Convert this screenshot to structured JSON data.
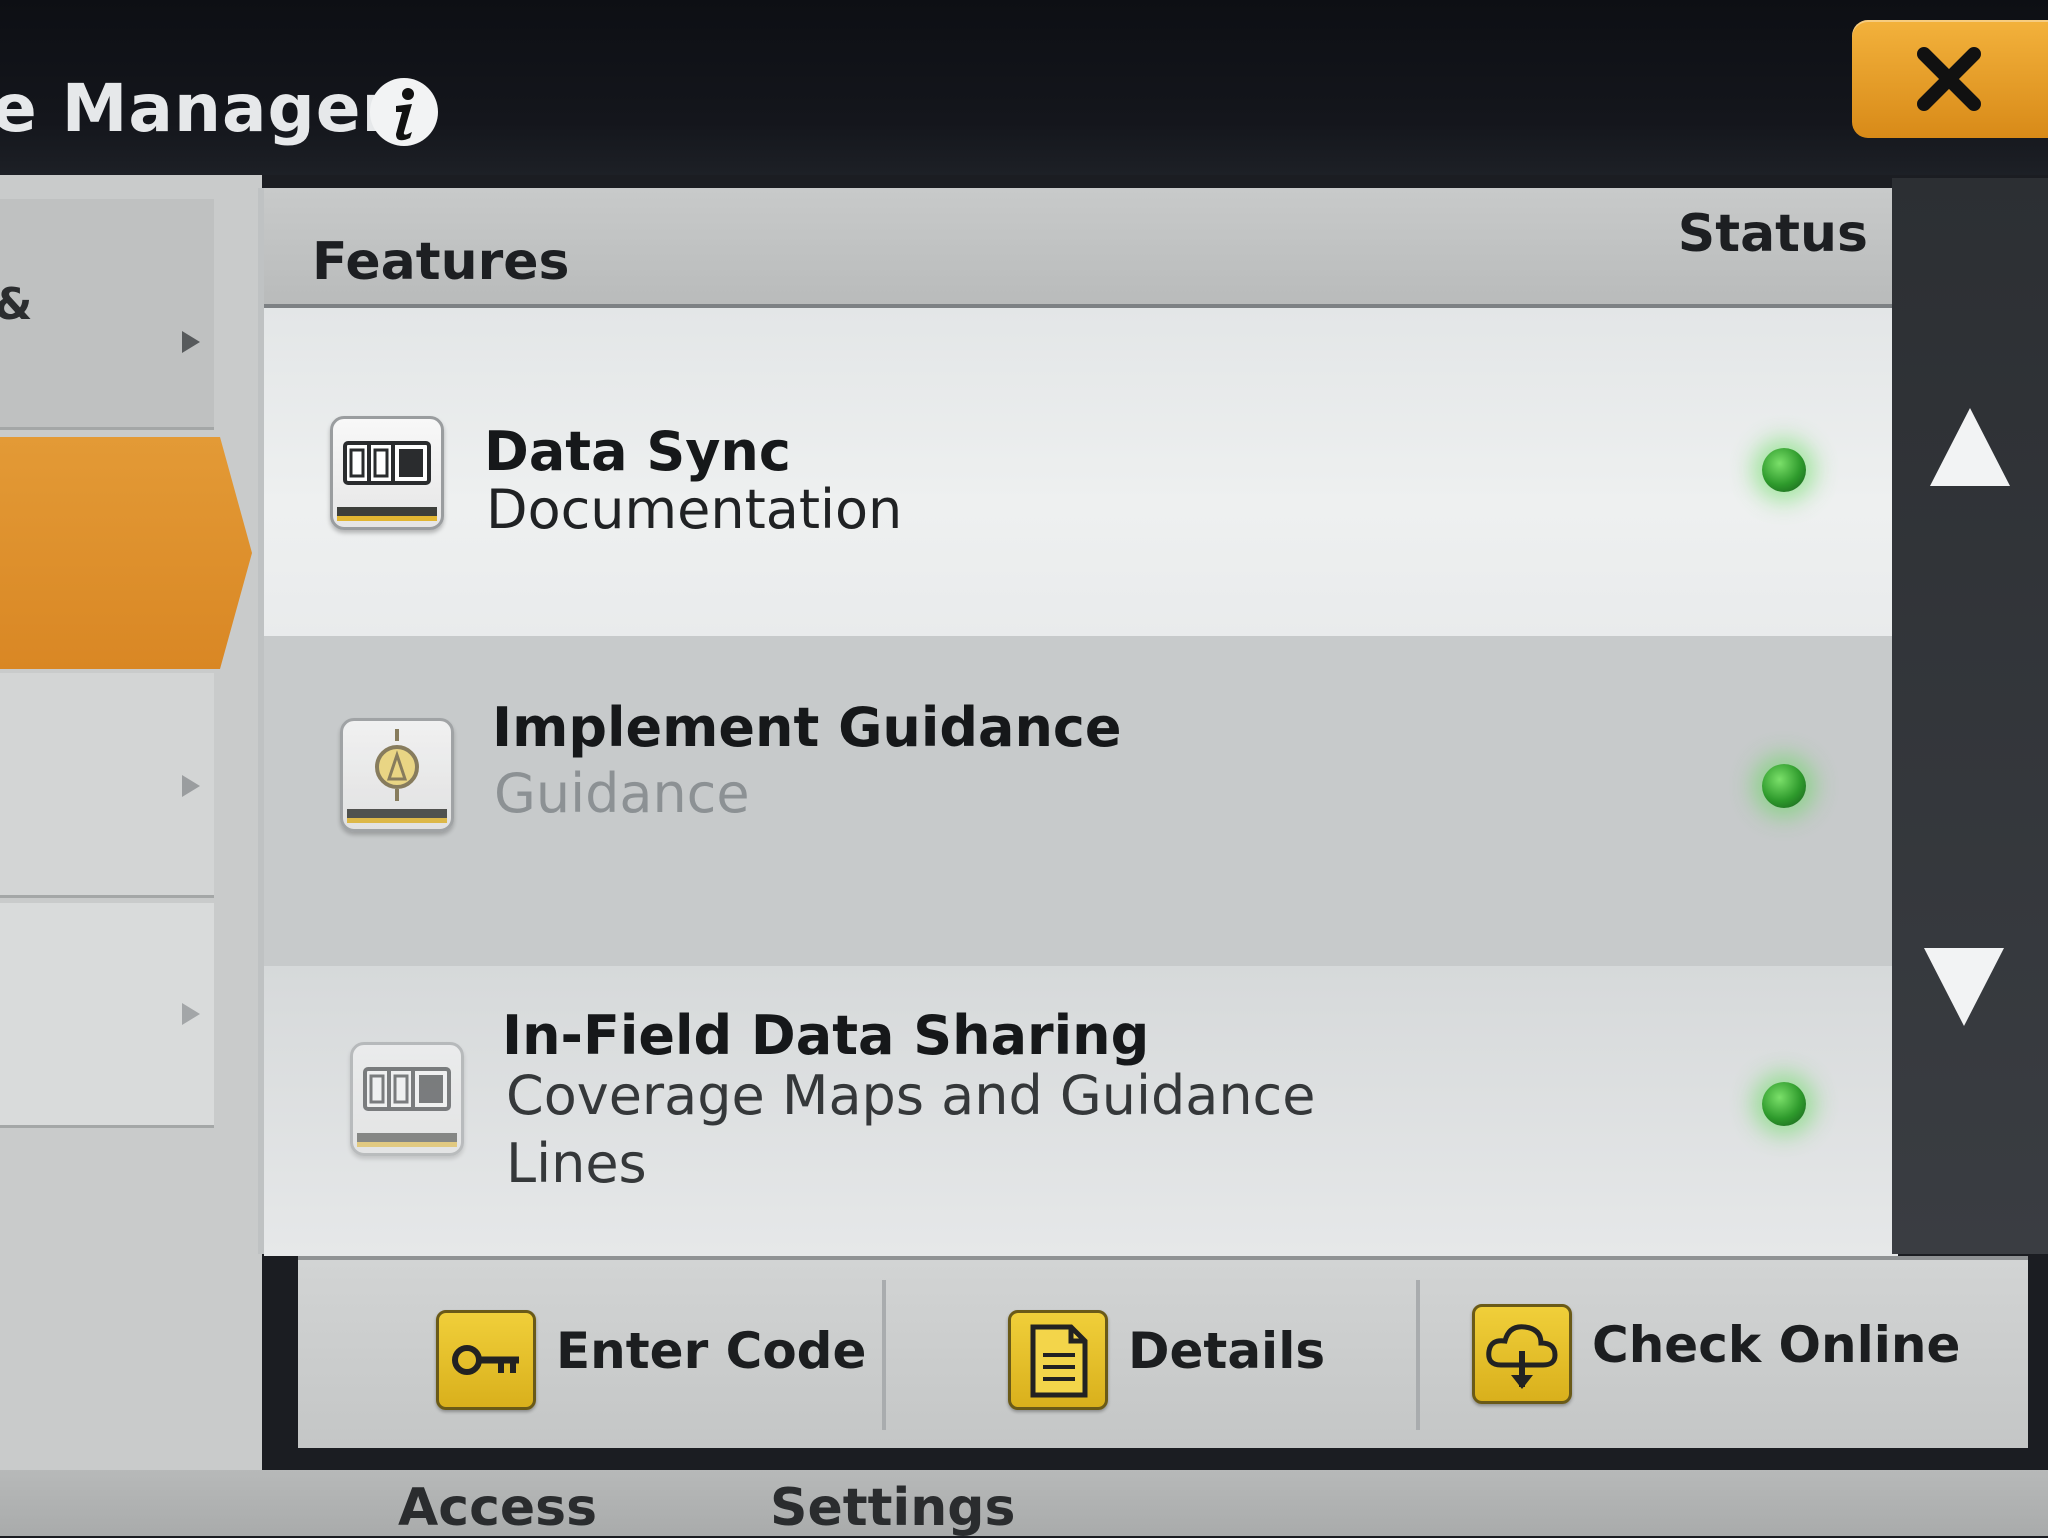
{
  "header": {
    "title": "e Manager",
    "info_icon": "info-icon",
    "close_icon": "close-icon"
  },
  "leftnav": {
    "items": [
      {
        "label": "&"
      },
      {
        "label": ""
      },
      {
        "label": ""
      },
      {
        "label": ""
      }
    ]
  },
  "table": {
    "columns": {
      "features": "Features",
      "status": "Status"
    },
    "rows": [
      {
        "name": "Data Sync",
        "description": "Documentation",
        "icon": "counter-icon",
        "status_color": "#2e9a2c"
      },
      {
        "name": "Implement Guidance",
        "description": "Guidance",
        "icon": "implement-guidance-icon",
        "status_color": "#2e9a2c"
      },
      {
        "name": "In-Field Data Sharing",
        "description": "Coverage Maps and Guidance Lines",
        "icon": "counter-icon",
        "status_color": "#2e9a2c"
      }
    ]
  },
  "footer": {
    "enter_code": "Enter Code",
    "details": "Details",
    "check_online": "Check Online"
  },
  "bottom_tabs": {
    "left": "Access",
    "right": "Settings"
  },
  "colors": {
    "accent": "#d98724",
    "button_icon": "#e0b82a",
    "status_ok": "#2e9a2c"
  }
}
